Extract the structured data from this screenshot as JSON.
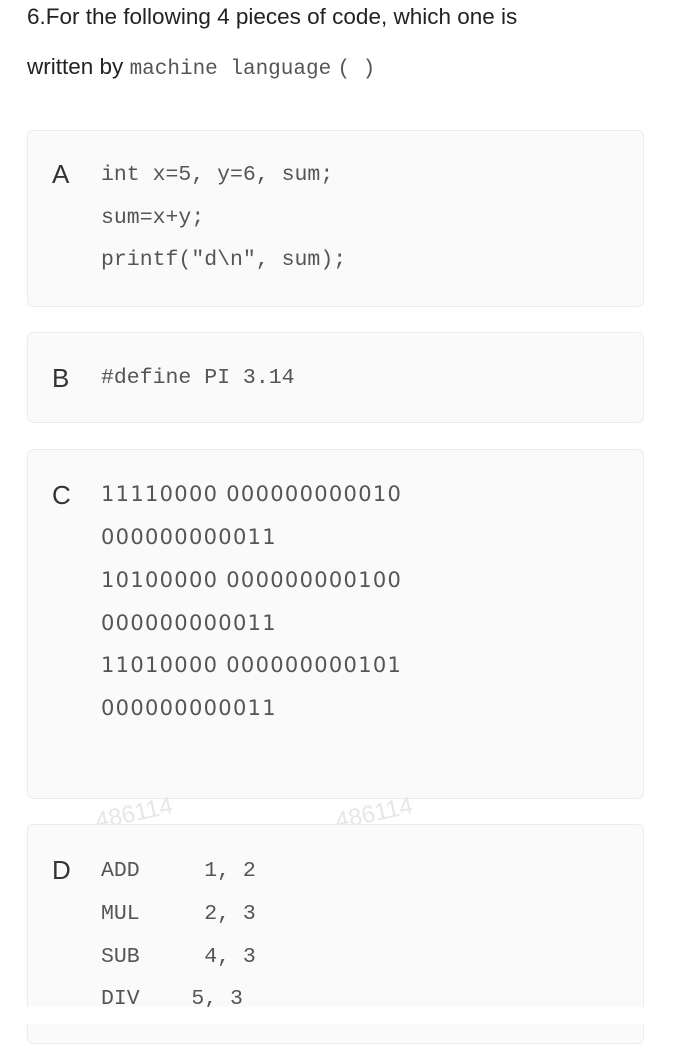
{
  "question": {
    "number": "6.",
    "text_part1": "For the following 4 pieces of code, which one is",
    "text_part2_prefix": "written by",
    "text_part2_mono": "machine language",
    "blank": "(   )"
  },
  "options": [
    {
      "letter": "A",
      "lines": [
        "int x=5, y=6, sum;",
        "sum=x+y;",
        "printf(\"d\\n\", sum);"
      ]
    },
    {
      "letter": "B",
      "lines": [
        "#define PI 3.14"
      ]
    },
    {
      "letter": "C",
      "lines": [
        "11110000 000000000010",
        "000000000011",
        "10100000 000000000100",
        "000000000011",
        "11010000 000000000101",
        "000000000011"
      ]
    },
    {
      "letter": "D",
      "lines": [
        "ADD     1, 2",
        "MUL     2, 3",
        "SUB     4, 3",
        "DIV    5, 3"
      ]
    }
  ],
  "watermark": "486114"
}
